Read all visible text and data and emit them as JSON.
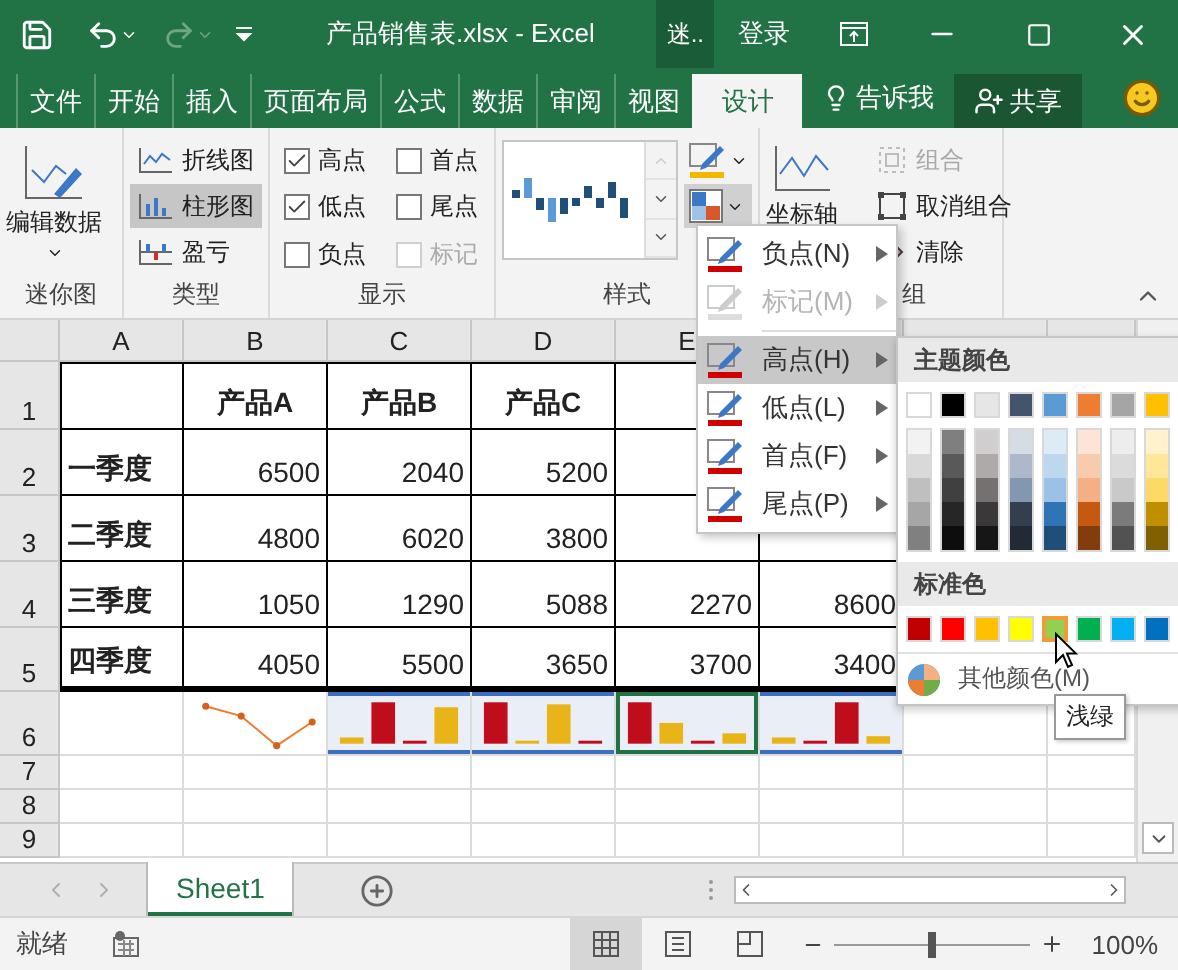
{
  "title_bar": {
    "title": "产品销售表.xlsx - Excel",
    "context_tab": "迷..",
    "sign_in": "登录"
  },
  "ribbon_tabs": [
    {
      "label": "文件",
      "selected": false
    },
    {
      "label": "开始",
      "selected": false
    },
    {
      "label": "插入",
      "selected": false
    },
    {
      "label": "页面布局",
      "selected": false
    },
    {
      "label": "公式",
      "selected": false
    },
    {
      "label": "数据",
      "selected": false
    },
    {
      "label": "审阅",
      "selected": false
    },
    {
      "label": "视图",
      "selected": false
    },
    {
      "label": "设计",
      "selected": true
    }
  ],
  "tell_me": "告诉我",
  "share": "共享",
  "ribbon": {
    "edit_group": {
      "label": "迷你图",
      "button": "编辑数据"
    },
    "type_group": {
      "label": "类型",
      "items": [
        {
          "label": "折线图",
          "kind": "line",
          "selected": false
        },
        {
          "label": "柱形图",
          "kind": "column",
          "selected": true
        },
        {
          "label": "盈亏",
          "kind": "winloss",
          "selected": false
        }
      ]
    },
    "show_group": {
      "label": "显示",
      "options": [
        {
          "label": "高点",
          "checked": true,
          "disabled": false
        },
        {
          "label": "首点",
          "checked": false,
          "disabled": false
        },
        {
          "label": "低点",
          "checked": true,
          "disabled": false
        },
        {
          "label": "尾点",
          "checked": false,
          "disabled": false
        },
        {
          "label": "负点",
          "checked": false,
          "disabled": false
        },
        {
          "label": "标记",
          "checked": false,
          "disabled": true
        }
      ]
    },
    "style_group": {
      "label": "样式"
    },
    "group_group": {
      "label": "组",
      "axis_button": "坐标轴",
      "buttons": [
        {
          "label": "组合",
          "kind": "group",
          "disabled": true
        },
        {
          "label": "取消组合",
          "kind": "ungroup",
          "disabled": false
        },
        {
          "label": "清除",
          "kind": "clear",
          "disabled": false
        }
      ]
    }
  },
  "sheet": {
    "columns": [
      "A",
      "B",
      "C",
      "D",
      "E"
    ],
    "rows": [
      {
        "header": "1",
        "cells": [
          null,
          "产品A",
          "产品B",
          "产品C",
          null,
          null
        ]
      },
      {
        "header": "2",
        "cells": [
          "一季度",
          "6500",
          "2040",
          "5200",
          null,
          null
        ]
      },
      {
        "header": "3",
        "cells": [
          "二季度",
          "4800",
          "6020",
          "3800",
          null,
          null
        ]
      },
      {
        "header": "4",
        "cells": [
          "三季度",
          "1050",
          "1290",
          "5088",
          "2270",
          "8600"
        ]
      },
      {
        "header": "5",
        "cells": [
          "四季度",
          "4050",
          "5500",
          "3650",
          "3700",
          "3400"
        ]
      }
    ],
    "sparkline_row": {
      "header": "6",
      "sparklines": [
        {
          "kind": "line",
          "selected": false,
          "active": false
        },
        {
          "kind": "column",
          "selected": true,
          "active": false
        },
        {
          "kind": "column",
          "selected": true,
          "active": false
        },
        {
          "kind": "column",
          "selected": true,
          "active": true
        },
        {
          "kind": "column",
          "selected": true,
          "active": false
        }
      ]
    },
    "empty_rows": [
      "7",
      "8",
      "9"
    ]
  },
  "sparkline_menu": {
    "sections": [
      [
        {
          "label": "负点(N)",
          "disabled": false,
          "selected": false
        },
        {
          "label": "标记(M)",
          "disabled": true,
          "selected": false
        }
      ],
      [
        {
          "label": "高点(H)",
          "disabled": false,
          "selected": true
        },
        {
          "label": "低点(L)",
          "disabled": false,
          "selected": false
        },
        {
          "label": "首点(F)",
          "disabled": false,
          "selected": false
        },
        {
          "label": "尾点(P)",
          "disabled": false,
          "selected": false
        }
      ]
    ]
  },
  "color_palette": {
    "theme_title": "主题颜色",
    "theme_colors": [
      {
        "color": "#ffffff",
        "shades": [
          {
            "color": "#f2f2f2"
          },
          {
            "color": "#d9d9d9"
          },
          {
            "color": "#bfbfbf"
          },
          {
            "color": "#a6a6a6"
          },
          {
            "color": "#808080"
          }
        ]
      },
      {
        "color": "#000000",
        "shades": [
          {
            "color": "#7f7f7f"
          },
          {
            "color": "#595959"
          },
          {
            "color": "#404040"
          },
          {
            "color": "#262626"
          },
          {
            "color": "#0d0d0d"
          }
        ]
      },
      {
        "color": "#e7e6e6",
        "shades": [
          {
            "color": "#d0cece"
          },
          {
            "color": "#aeaaaa"
          },
          {
            "color": "#757171"
          },
          {
            "color": "#3a3838"
          },
          {
            "color": "#171616"
          }
        ]
      },
      {
        "color": "#44546a",
        "shades": [
          {
            "color": "#d6dce4"
          },
          {
            "color": "#adb9ca"
          },
          {
            "color": "#8497b0"
          },
          {
            "color": "#333f4f"
          },
          {
            "color": "#222b35"
          }
        ]
      },
      {
        "color": "#5b9bd5",
        "shades": [
          {
            "color": "#ddebf7"
          },
          {
            "color": "#bdd7ee"
          },
          {
            "color": "#9bc2e6"
          },
          {
            "color": "#2f75b5"
          },
          {
            "color": "#1f4e78"
          }
        ]
      },
      {
        "color": "#ed7d31",
        "shades": [
          {
            "color": "#fce4d6"
          },
          {
            "color": "#f8cbad"
          },
          {
            "color": "#f4b084"
          },
          {
            "color": "#c65911"
          },
          {
            "color": "#833c0c"
          }
        ]
      },
      {
        "color": "#a5a5a5",
        "shades": [
          {
            "color": "#ededed"
          },
          {
            "color": "#dbdbdb"
          },
          {
            "color": "#c9c9c9"
          },
          {
            "color": "#7b7b7b"
          },
          {
            "color": "#525252"
          }
        ]
      },
      {
        "color": "#ffc000",
        "shades": [
          {
            "color": "#fff2cc"
          },
          {
            "color": "#ffe699"
          },
          {
            "color": "#ffd966"
          },
          {
            "color": "#bf8f00"
          },
          {
            "color": "#806000"
          }
        ]
      }
    ],
    "standard_title": "标准色",
    "standard_colors": [
      {
        "color": "#c00000",
        "selected": false
      },
      {
        "color": "#ff0000",
        "selected": false
      },
      {
        "color": "#ffc000",
        "selected": false
      },
      {
        "color": "#ffff00",
        "selected": false
      },
      {
        "color": "#92d050",
        "selected": true
      },
      {
        "color": "#00b050",
        "selected": false
      },
      {
        "color": "#00b0f0",
        "selected": false
      },
      {
        "color": "#0070c0",
        "selected": false
      }
    ],
    "more_colors": "其他颜色(M)",
    "tooltip": "浅绿"
  },
  "sheet_tabs": [
    {
      "label": "Sheet1",
      "selected": true
    }
  ],
  "status_bar": {
    "text": "就绪",
    "views": [
      {
        "kind": "normal",
        "selected": true
      },
      {
        "kind": "page-layout",
        "selected": false
      },
      {
        "kind": "page-break",
        "selected": false
      }
    ],
    "zoom_slider": {
      "level": 0.5
    },
    "zoom": "100%"
  }
}
